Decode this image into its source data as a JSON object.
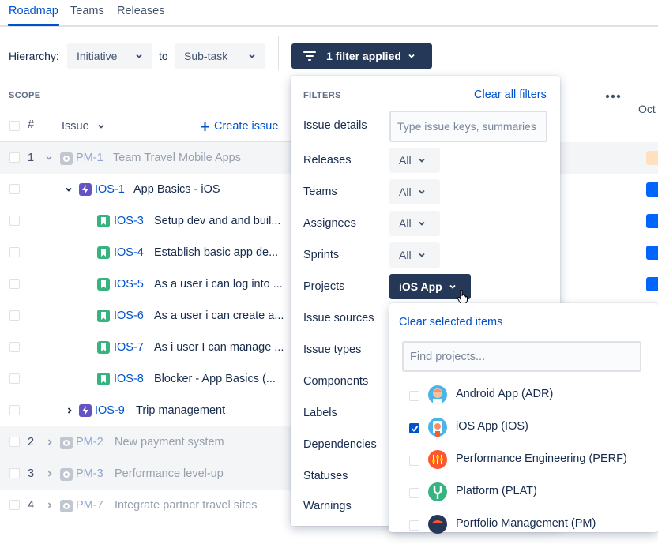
{
  "tabs": [
    {
      "label": "Roadmap",
      "active": true
    },
    {
      "label": "Teams",
      "active": false
    },
    {
      "label": "Releases",
      "active": false
    }
  ],
  "toolbar": {
    "hierarchy_label": "Hierarchy:",
    "from_value": "Initiative",
    "to_label": "to",
    "to_value": "Sub-task",
    "filter_button": "1 filter applied"
  },
  "scope": {
    "title": "SCOPE",
    "num_header": "#",
    "issue_header": "Issue",
    "create_issue": "Create issue",
    "more_icon": "more-icon"
  },
  "timeline": {
    "month_label": "Oct"
  },
  "rows": [
    {
      "num": "1",
      "key": "PM-1",
      "summary": "Team Travel Mobile Apps",
      "dim": true,
      "icon": "initiative-icon"
    },
    {
      "num": "",
      "key": "IOS-1",
      "summary": "App Basics - iOS",
      "dim": false,
      "icon": "epic-icon",
      "expanded": true
    },
    {
      "num": "",
      "key": "IOS-3",
      "summary": "Setup dev and and buil...",
      "dim": false,
      "icon": "story-icon"
    },
    {
      "num": "",
      "key": "IOS-4",
      "summary": "Establish basic app de...",
      "dim": false,
      "icon": "story-icon"
    },
    {
      "num": "",
      "key": "IOS-5",
      "summary": "As a user i can log into ...",
      "dim": false,
      "icon": "story-icon"
    },
    {
      "num": "",
      "key": "IOS-6",
      "summary": "As a user i can create a...",
      "dim": false,
      "icon": "story-icon"
    },
    {
      "num": "",
      "key": "IOS-7",
      "summary": "As i user I can manage ...",
      "dim": false,
      "icon": "story-icon"
    },
    {
      "num": "",
      "key": "IOS-8",
      "summary": "Blocker - App Basics (...",
      "dim": false,
      "icon": "story-icon"
    },
    {
      "num": "",
      "key": "IOS-9",
      "summary": "Trip management",
      "dim": false,
      "icon": "epic-icon",
      "expanded": false
    },
    {
      "num": "2",
      "key": "PM-2",
      "summary": "New payment system",
      "dim": true,
      "icon": "initiative-icon"
    },
    {
      "num": "3",
      "key": "PM-3",
      "summary": "Performance level-up",
      "dim": true,
      "icon": "initiative-icon"
    },
    {
      "num": "4",
      "key": "PM-7",
      "summary": "Integrate partner travel sites",
      "dim": true,
      "icon": "initiative-icon"
    }
  ],
  "filters": {
    "title": "FILTERS",
    "clear_all": "Clear all filters",
    "issue_details_label": "Issue details",
    "issue_details_placeholder": "Type issue keys, summaries",
    "releases_label": "Releases",
    "releases_value": "All",
    "teams_label": "Teams",
    "teams_value": "All",
    "assignees_label": "Assignees",
    "assignees_value": "All",
    "sprints_label": "Sprints",
    "sprints_value": "All",
    "projects_label": "Projects",
    "projects_value": "iOS App",
    "issue_sources_label": "Issue sources",
    "issue_types_label": "Issue types",
    "components_label": "Components",
    "labels_label": "Labels",
    "dependencies_label": "Dependencies",
    "statuses_label": "Statuses",
    "warnings_label": "Warnings"
  },
  "projects_dropdown": {
    "clear_selected": "Clear selected items",
    "search_placeholder": "Find projects...",
    "options": [
      {
        "name": "Android App (ADR)",
        "checked": false
      },
      {
        "name": "iOS App (IOS)",
        "checked": true
      },
      {
        "name": "Performance Engineering (PERF)",
        "checked": false
      },
      {
        "name": "Platform (PLAT)",
        "checked": false
      },
      {
        "name": "Portfolio Management (PM)",
        "checked": false
      }
    ]
  },
  "colors": {
    "brand_blue": "#0052cc",
    "dark_button": "#253858",
    "story_green": "#36b37e",
    "epic_purple": "#6554c0",
    "timeline_blue": "#0065ff",
    "timeline_orange": "#ffe2bd"
  }
}
